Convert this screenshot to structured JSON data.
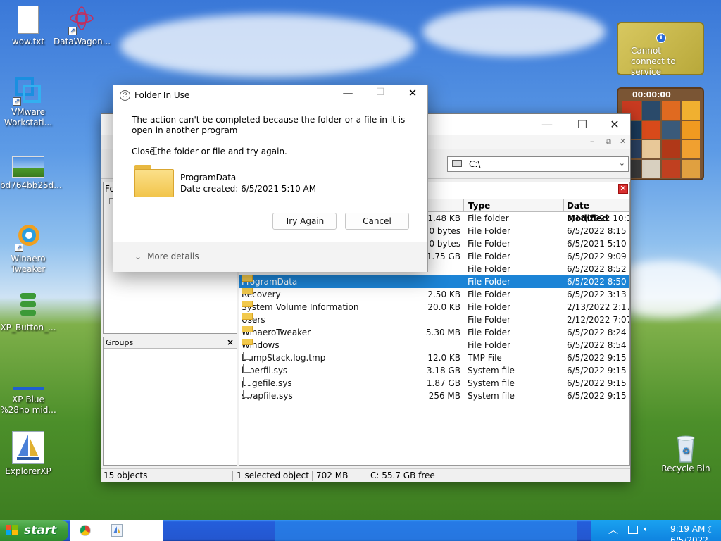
{
  "desktop": {
    "icons": [
      {
        "label": "wow.txt"
      },
      {
        "label": "DataWagon..."
      },
      {
        "label": "VMware Workstati..."
      },
      {
        "label": "bd764bb25d..."
      },
      {
        "label": "Winaero Tweaker"
      },
      {
        "label": "XP_Button_..."
      },
      {
        "label": "XP Blue %28no mid..."
      },
      {
        "label": "ExplorerXP"
      },
      {
        "label": "Recycle Bin"
      }
    ]
  },
  "weather_gadget": {
    "message": "Cannot connect to service"
  },
  "puzzle_gadget": {
    "timer": "00:00:00"
  },
  "explorer": {
    "address": "C:\\",
    "folders_label": "Fo",
    "groups_label": "Groups",
    "columns": [
      "Type",
      "Date Modified"
    ],
    "rows": [
      {
        "name": "",
        "size": "1.48 KB",
        "type": "File folder",
        "date": "3/18/2022 10:1...",
        "icon": "folder"
      },
      {
        "name": "",
        "size": "0 bytes",
        "type": "File Folder",
        "date": "6/5/2022 8:15 ...",
        "icon": "folder"
      },
      {
        "name": "",
        "size": "0 bytes",
        "type": "File Folder",
        "date": "6/5/2021 5:10 ...",
        "icon": "folder"
      },
      {
        "name": "",
        "size": "1.75 GB",
        "type": "File Folder",
        "date": "6/5/2022 9:09 ...",
        "icon": "folder"
      },
      {
        "name": "",
        "size": "",
        "type": "File Folder",
        "date": "6/5/2022 8:52 ...",
        "icon": "folder"
      },
      {
        "name": "ProgramData",
        "size": "",
        "type": "File Folder",
        "date": "6/5/2022 8:50 ...",
        "icon": "folder",
        "selected": true
      },
      {
        "name": "Recovery",
        "size": "2.50 KB",
        "type": "File Folder",
        "date": "6/5/2022 3:13 P...",
        "icon": "folder"
      },
      {
        "name": "System Volume Information",
        "size": "20.0 KB",
        "type": "File Folder",
        "date": "2/13/2022 2:17 ...",
        "icon": "folder"
      },
      {
        "name": "Users",
        "size": "",
        "type": "File Folder",
        "date": "2/12/2022 7:07 ...",
        "icon": "folder"
      },
      {
        "name": "WinaeroTweaker",
        "size": "5.30 MB",
        "type": "File Folder",
        "date": "6/5/2022 8:24 ...",
        "icon": "folder"
      },
      {
        "name": "Windows",
        "size": "",
        "type": "File Folder",
        "date": "6/5/2022 8:54 ...",
        "icon": "folder"
      },
      {
        "name": "DumpStack.log.tmp",
        "size": "12.0 KB",
        "type": "TMP File",
        "date": "6/5/2022 9:15 ...",
        "icon": "file"
      },
      {
        "name": "hiberfil.sys",
        "size": "3.18 GB",
        "type": "System file",
        "date": "6/5/2022 9:15 ...",
        "icon": "file"
      },
      {
        "name": "pagefile.sys",
        "size": "1.87 GB",
        "type": "System file",
        "date": "6/5/2022 9:15 ...",
        "icon": "file"
      },
      {
        "name": "swapfile.sys",
        "size": "256 MB",
        "type": "System file",
        "date": "6/5/2022 9:15 ...",
        "icon": "file"
      }
    ],
    "status": {
      "objects": "15 objects",
      "selected": "1 selected object",
      "size": "702 MB",
      "free": "C: 55.7 GB free"
    }
  },
  "dialog": {
    "title": "Folder In Use",
    "message": "The action can't be completed because the folder or a file in it is open in another program",
    "instruction": "Close the folder or file and try again.",
    "item_name": "ProgramData",
    "item_date": "Date created: 6/5/2021 5:10 AM",
    "try_again": "Try Again",
    "cancel": "Cancel",
    "more_details": "More details"
  },
  "taskbar": {
    "start_label": "start",
    "clock_time": "9:19 AM",
    "clock_date": "6/5/2022"
  },
  "colors": {
    "selection": "#1c84d6",
    "taskbar": "#2457d0",
    "start": "#3c9a37"
  }
}
